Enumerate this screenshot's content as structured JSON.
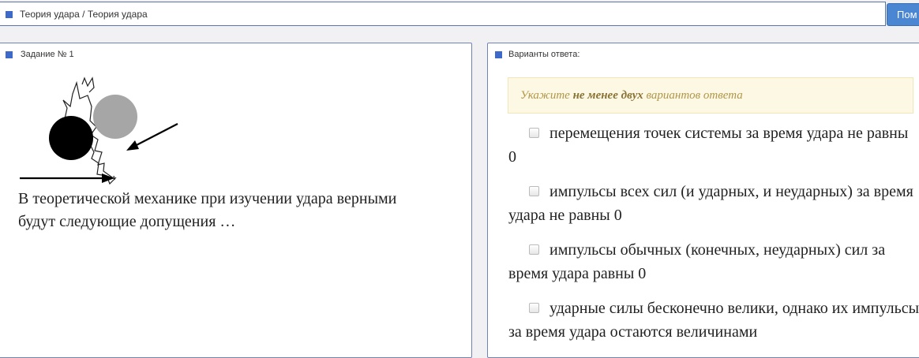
{
  "breadcrumb": "Теория удара / Теория удара",
  "help_button": "Пом",
  "task_panel": {
    "title": "Задание № 1",
    "question": "В теоретической механике при изучении удара верными будут следующие допущения …"
  },
  "answers_panel": {
    "title": "Варианты ответа:",
    "hint": {
      "prefix": "Укажите ",
      "emphasis": "не менее двух",
      "suffix": " вариантов ответа"
    },
    "options": [
      "перемещения точек системы за время удара не равны 0",
      "импульсы всех сил (и ударных, и неударных) за время удара не равны 0",
      "импульсы обычных (конечных, неударных) сил за время удара равны 0",
      "ударные силы бесконечно велики, однако их импульсы за время удара остаются величинами"
    ]
  },
  "colors": {
    "accent": "#3d6ac8",
    "button": "#4a86d2",
    "hint_bg": "#fcf8e3",
    "hint_text": "#b09649"
  }
}
